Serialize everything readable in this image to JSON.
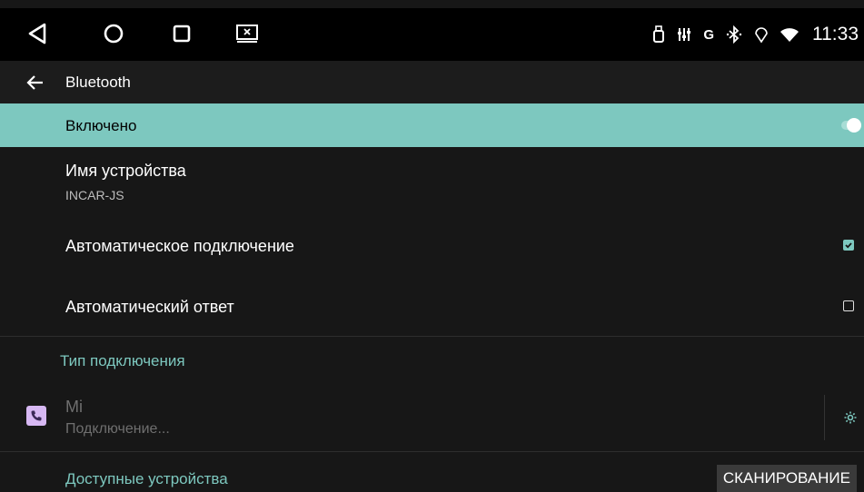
{
  "status_bar": {
    "time": "11:33",
    "indicator_g": "G"
  },
  "app_bar": {
    "title": "Bluetooth"
  },
  "settings": {
    "enabled_label": "Включено",
    "enabled": true,
    "device_name_label": "Имя устройства",
    "device_name_value": "INCAR-JS",
    "auto_connect_label": "Автоматическое подключение",
    "auto_connect_checked": true,
    "auto_answer_label": "Автоматический ответ",
    "auto_answer_checked": false
  },
  "connection_section": {
    "title": "Тип подключения",
    "device": {
      "name": "Mi",
      "status": "Подключение..."
    }
  },
  "available_section": {
    "title": "Доступные устройства",
    "scan_label": "СКАНИРОВАНИЕ"
  },
  "colors": {
    "accent": "#7dc8bf",
    "background": "#171717",
    "status_bar": "#000000",
    "device_icon_bg": "#d7b8f3"
  },
  "icons": {
    "nav": [
      "back-triangle-icon",
      "home-circle-icon",
      "recents-square-icon",
      "screen-cast-icon"
    ],
    "status": [
      "usb-icon",
      "equalizer-icon",
      "g-icon",
      "bluetooth-icon",
      "location-icon",
      "wifi-icon"
    ],
    "app_bar_back": "arrow-left-icon",
    "device": "phone-icon",
    "device_settings": "gear-icon"
  }
}
